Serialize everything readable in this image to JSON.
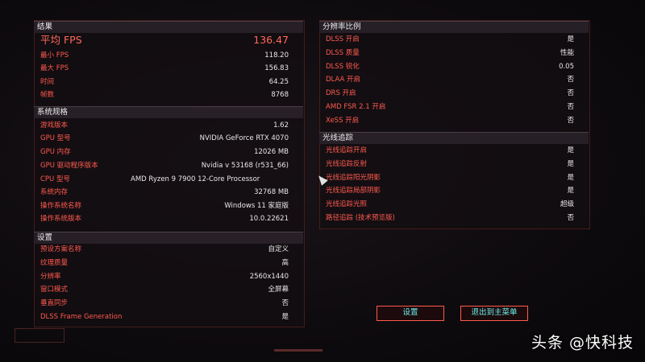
{
  "results": {
    "header": "结果",
    "avg_fps_label": "平均 FPS",
    "avg_fps": "136.47",
    "rows": [
      {
        "label": "最小 FPS",
        "value": "118.20"
      },
      {
        "label": "最大 FPS",
        "value": "156.83"
      },
      {
        "label": "时间",
        "value": "64.25"
      },
      {
        "label": "帧数",
        "value": "8768"
      }
    ]
  },
  "system": {
    "header": "系统规格",
    "rows": [
      {
        "label": "游戏版本",
        "value": "1.62"
      },
      {
        "label": "GPU 型号",
        "value": "NVIDIA GeForce RTX 4070"
      },
      {
        "label": "GPU 内存",
        "value": "12026 MB"
      },
      {
        "label": "GPU 驱动程序版本",
        "value": "Nvidia v 53168 (r531_66)"
      },
      {
        "label": "CPU 型号",
        "value": "AMD Ryzen 9 7900 12-Core Processor"
      },
      {
        "label": "系统内存",
        "value": "32768 MB"
      },
      {
        "label": "操作系统名称",
        "value": "Windows 11 家庭版"
      },
      {
        "label": "操作系统版本",
        "value": "10.0.22621"
      }
    ]
  },
  "settings": {
    "header": "设置",
    "rows": [
      {
        "label": "预设方案名称",
        "value": "自定义"
      },
      {
        "label": "纹理质量",
        "value": "高"
      },
      {
        "label": "分辨率",
        "value": "2560x1440"
      },
      {
        "label": "窗口模式",
        "value": "全屏幕"
      },
      {
        "label": "垂直同步",
        "value": "否"
      },
      {
        "label": "DLSS Frame Generation",
        "value": "是"
      }
    ]
  },
  "resolution_scale": {
    "header": "分辨率比例",
    "rows": [
      {
        "label": "DLSS 开启",
        "value": "是"
      },
      {
        "label": "DLSS 质量",
        "value": "性能"
      },
      {
        "label": "DLSS 锐化",
        "value": "0.05"
      },
      {
        "label": "DLAA 开启",
        "value": "否"
      },
      {
        "label": "DRS 开启",
        "value": "否"
      },
      {
        "label": "AMD FSR 2.1 开启",
        "value": "否"
      },
      {
        "label": "XeSS 开启",
        "value": "否"
      }
    ]
  },
  "raytracing": {
    "header": "光线追踪",
    "rows": [
      {
        "label": "光线追踪开启",
        "value": "是"
      },
      {
        "label": "光线追踪反射",
        "value": "是"
      },
      {
        "label": "光线追踪阳光阴影",
        "value": "是"
      },
      {
        "label": "光线追踪局部阴影",
        "value": "是"
      },
      {
        "label": "光线追踪光照",
        "value": "超级"
      },
      {
        "label": "路径追踪 (技术预览版)",
        "value": "否"
      }
    ]
  },
  "buttons": {
    "settings": "设置",
    "exit": "退出到主菜单"
  },
  "watermark": "头条 @快科技",
  "colors": {
    "accent": "#ff5a4e",
    "value": "#e8e8e8",
    "button_text": "#6ef0f0"
  }
}
